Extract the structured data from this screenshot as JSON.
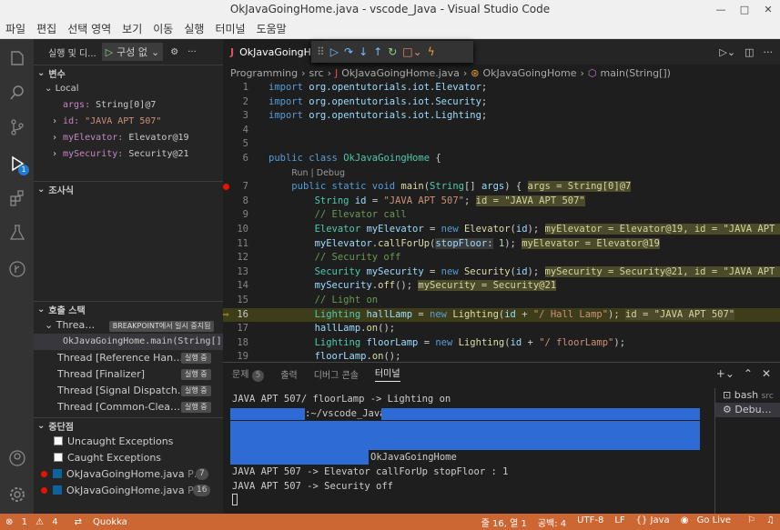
{
  "window": {
    "title": "OkJavaGoingHome.java - vscode_Java - Visual Studio Code",
    "min": "—",
    "max": "□",
    "close": "✕"
  },
  "menu": [
    "파일",
    "편집",
    "선택 영역",
    "보기",
    "이동",
    "실행",
    "터미널",
    "도움말"
  ],
  "sidebar": {
    "run_label": "실행 및 디...",
    "config": "구성 없",
    "variables_title": "변수",
    "local_label": "Local",
    "vars": [
      {
        "key": "args:",
        "val": "String[0]@7"
      },
      {
        "key": "id:",
        "val": "\"JAVA APT 507\""
      },
      {
        "key": "myElevator:",
        "val": "Elevator@19"
      },
      {
        "key": "mySecurity:",
        "val": "Security@21"
      }
    ],
    "watch_title": "조사식",
    "callstack_title": "호출 스택",
    "threads": [
      {
        "name": "Threa…",
        "tag": "BREAKPOINT에서 일시 중지됨"
      },
      {
        "name": "OkJavaGoingHome.main(String[])",
        "tag": ""
      },
      {
        "name": "Thread [Reference Han…",
        "tag": "실행 중"
      },
      {
        "name": "Thread [Finalizer]",
        "tag": "실행 중"
      },
      {
        "name": "Thread [Signal Dispatch…",
        "tag": "실행 중"
      },
      {
        "name": "Thread [Common-Clea…",
        "tag": "실행 중"
      }
    ],
    "breakpoints_title": "중단점",
    "breakpoints": [
      {
        "label": "Uncaught Exceptions",
        "checked": false,
        "count": ""
      },
      {
        "label": "Caught Exceptions",
        "checked": false,
        "count": ""
      },
      {
        "label": "OkJavaGoingHome.java",
        "checked": true,
        "suffix": "P…",
        "count": "7"
      },
      {
        "label": "OkJavaGoingHome.java",
        "checked": true,
        "suffix": "P…",
        "count": "16"
      }
    ]
  },
  "editor": {
    "tab_icon": "J",
    "tab_label": "OkJavaGoingHo",
    "breadcrumb": [
      "Programming",
      "src",
      "OkJavaGoingHome.java",
      "OkJavaGoingHome",
      "main(String[])"
    ],
    "run_debug_lens": "Run | Debug"
  },
  "panel": {
    "tabs": [
      "문제",
      "출력",
      "디버그 콘솔",
      "터미널"
    ],
    "problems_count": "5",
    "terminal_lines": [
      "JAVA APT 507/ floorLamp -> Lighting on",
      ":~/vscode_Java$",
      "",
      "",
      "OkJavaGoingHome",
      "JAVA APT 507 -> Elevator callForUp stopFloor : 1",
      "JAVA APT 507 -> Security off"
    ],
    "terminals": [
      {
        "name": "bash",
        "suffix": "src"
      },
      {
        "name": "Debu…",
        "suffix": ""
      }
    ]
  },
  "status": {
    "errors": "1",
    "warnings": "4",
    "quokka": "Quokka",
    "position": "줄 16, 열 1",
    "spaces": "공백: 4",
    "encoding": "UTF-8",
    "eol": "LF",
    "lang": "{} Java",
    "golive": "Go Live"
  },
  "colors": {
    "statusbar": "#cc6633",
    "accent": "#0e639c",
    "breakpoint": "#e51400"
  }
}
